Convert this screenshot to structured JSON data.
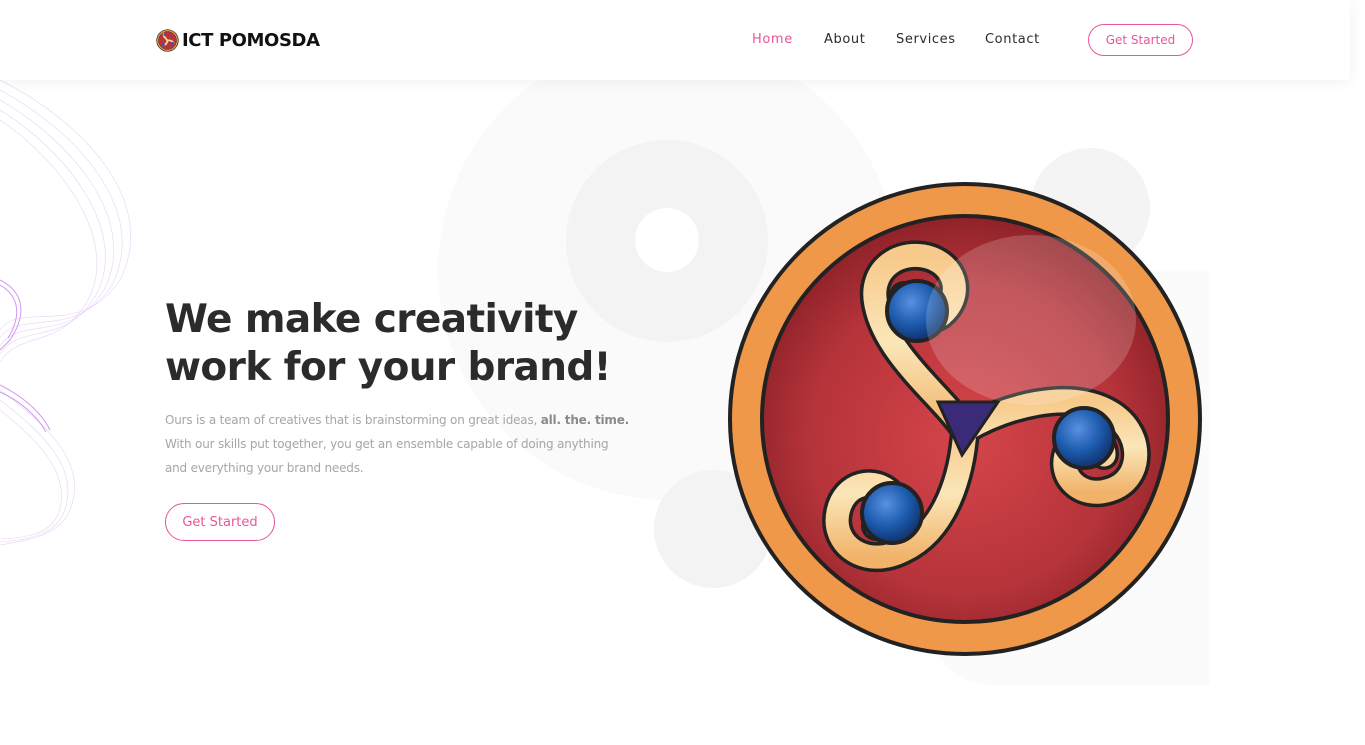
{
  "header": {
    "brand": "ICT POMOSDA",
    "nav": [
      {
        "label": "Home",
        "active": true
      },
      {
        "label": "About",
        "active": false
      },
      {
        "label": "Services",
        "active": false
      },
      {
        "label": "Contact",
        "active": false
      }
    ],
    "cta_label": "Get Started"
  },
  "hero": {
    "title_line1": "We make creativity",
    "title_line2": "work for your brand!",
    "desc_part1": "Ours is a team of creatives that is brainstorming on great ideas, ",
    "desc_emphasis": "all. the. time.",
    "desc_line2": "With our skills put together, you get an ensemble capable of doing anything",
    "desc_line3": "and everything your brand needs.",
    "cta_label": "Get Started"
  },
  "colors": {
    "accent": "#e8559b",
    "emblem_ring": "#f0984a",
    "emblem_center": "#c0393f",
    "emblem_spiral": "#f7d59c",
    "emblem_dots": "#1e5db0"
  },
  "icons": {
    "brand_logo": "triskelion-logo-icon",
    "hero_emblem": "triskelion-emblem-icon"
  }
}
